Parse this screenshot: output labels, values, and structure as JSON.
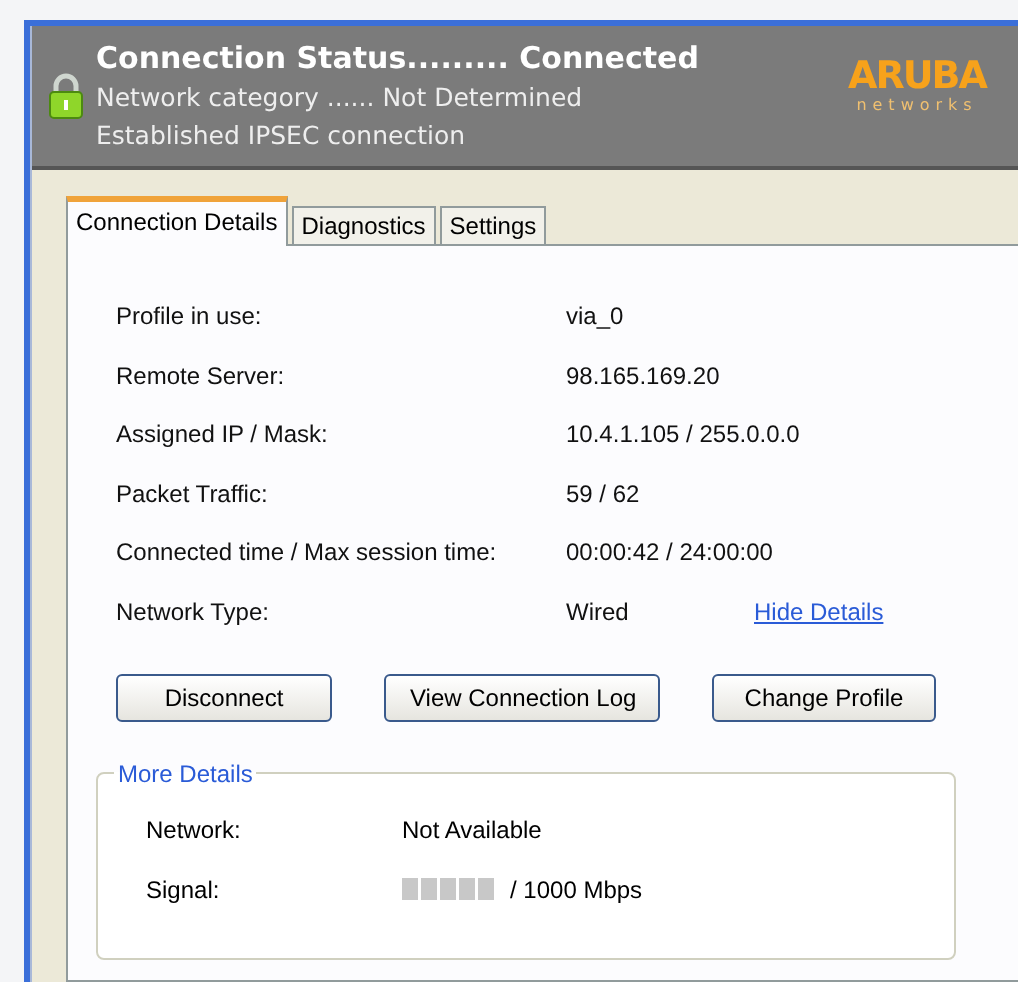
{
  "header": {
    "status": "Connection Status......... Connected",
    "category": "Network category ...... Not Determined",
    "message": "Established IPSEC connection",
    "logo": {
      "name": "ARUBA",
      "tagline": "networks"
    }
  },
  "tabs": [
    {
      "label": "Connection Details",
      "selected": true
    },
    {
      "label": "Diagnostics",
      "selected": false
    },
    {
      "label": "Settings",
      "selected": false
    }
  ],
  "details": [
    {
      "label": "Profile in use:",
      "value": "via_0"
    },
    {
      "label": "Remote Server:",
      "value": "98.165.169.20"
    },
    {
      "label": "Assigned IP / Mask:",
      "value": "10.4.1.105 / 255.0.0.0"
    },
    {
      "label": "Packet Traffic:",
      "value": "59 / 62"
    },
    {
      "label": "Connected time / Max session time:",
      "value": "00:00:42 / 24:00:00"
    },
    {
      "label": "Network Type:",
      "value": "Wired",
      "link": "Hide Details"
    }
  ],
  "buttons": [
    "Disconnect",
    "View Connection Log",
    "Change Profile"
  ],
  "more_details": {
    "title": "More Details",
    "rows": [
      {
        "kind": "text",
        "label": "Network:",
        "value": "Not Available"
      },
      {
        "kind": "signal",
        "label": "Signal:",
        "value": "/ 1000 Mbps"
      }
    ]
  }
}
